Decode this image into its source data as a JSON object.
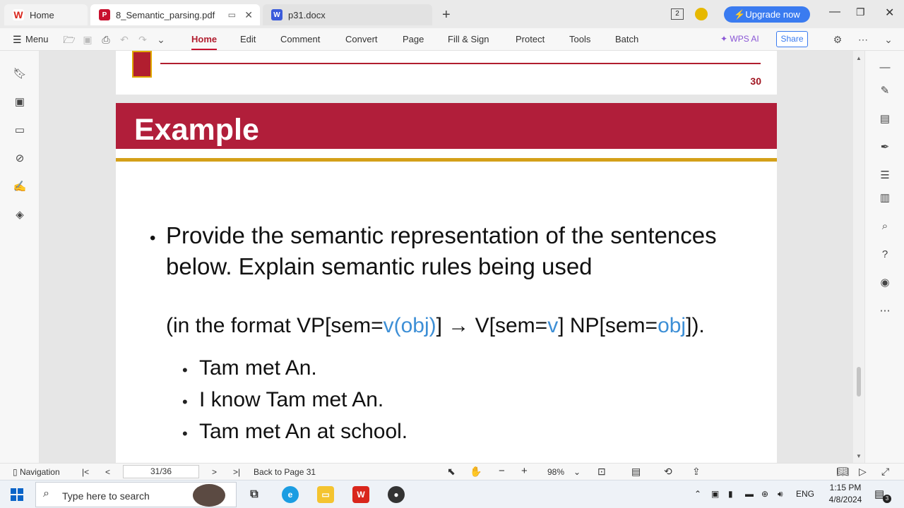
{
  "tabs": [
    {
      "label": "Home"
    },
    {
      "label": "8_Semantic_parsing.pdf"
    },
    {
      "label": "p31.docx"
    }
  ],
  "titlebar": {
    "badge": "2",
    "upgrade_label": "Upgrade now",
    "new_tab": "+"
  },
  "ribbon": {
    "menu_label": "Menu",
    "items": [
      "Home",
      "Edit",
      "Comment",
      "Convert",
      "Page",
      "Fill & Sign",
      "Protect",
      "Tools",
      "Batch"
    ],
    "wps_ai": "WPS AI",
    "share": "Share"
  },
  "document": {
    "prev_page_number": "30",
    "slide_title": "Example",
    "bullet_main": "Provide the semantic representation of the sentences below. Explain semantic rules being used",
    "format": {
      "p1": "(in the format VP[sem=",
      "b1": "v(obj)",
      "p2": "] → V[sem=",
      "b2": "v",
      "p3": "]  NP[sem=",
      "b3": "obj",
      "p4": "])."
    },
    "sentences": [
      "Tam met An.",
      "I know Tam met An.",
      "Tam met An at school."
    ]
  },
  "statusbar": {
    "navigation": "Navigation",
    "page_value": "31/36",
    "back_to": "Back to Page 31",
    "zoom": "98%"
  },
  "taskbar": {
    "search_placeholder": "Type here to search",
    "lang": "ENG",
    "time": "1:15 PM",
    "date": "4/8/2024",
    "notif_count": "3"
  },
  "colors": {
    "accent": "#c8102e",
    "slide_bar": "#b11e3a",
    "gold": "#d4a019",
    "blue_text": "#3d8fd6",
    "upgrade": "#3a7bf0"
  }
}
